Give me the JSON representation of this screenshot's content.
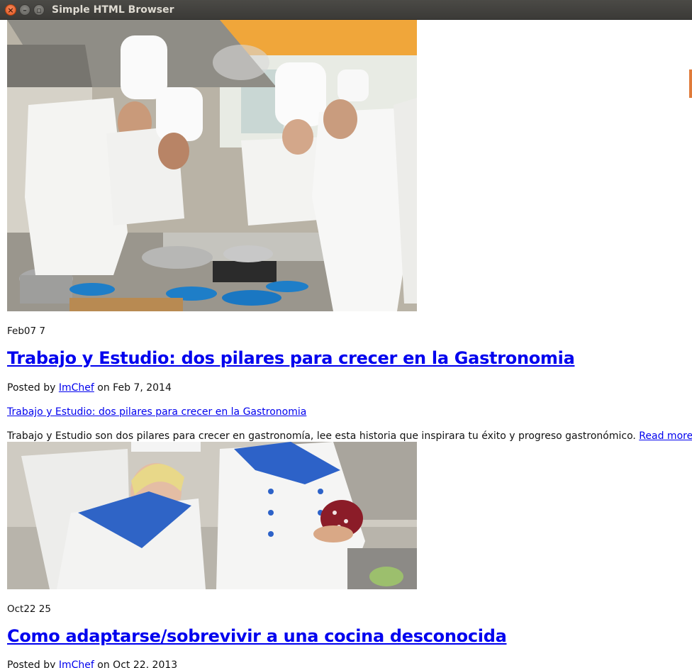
{
  "window": {
    "title": "Simple HTML Browser",
    "close_glyph": "×",
    "min_glyph": "–",
    "max_glyph": "▫"
  },
  "posts": [
    {
      "date_badge": "Feb07 7",
      "title": "Trabajo y Estudio: dos pilares para crecer en la Gastronomia",
      "posted_prefix": "Posted by",
      "author": "ImChef",
      "posted_date": "on Feb 7, 2014",
      "category_link": "Trabajo y Estudio: dos pilares para crecer en la Gastronomia",
      "excerpt": "Trabajo y Estudio son dos pilares para crecer en gastronomía, lee esta historia que inspirara tu éxito y progreso gastronómico.",
      "read_more": "Read more"
    },
    {
      "date_badge": "Oct22 25",
      "title": "Como adaptarse/sobrevivir a una cocina desconocida",
      "posted_prefix": "Posted by",
      "author": "ImChef",
      "posted_date": "on Oct 22, 2013"
    }
  ],
  "colors": {
    "link": "#0000ee",
    "titlebar": "#3c3b37",
    "close_button": "#e95420",
    "scroll_marker": "#e07b3a"
  }
}
